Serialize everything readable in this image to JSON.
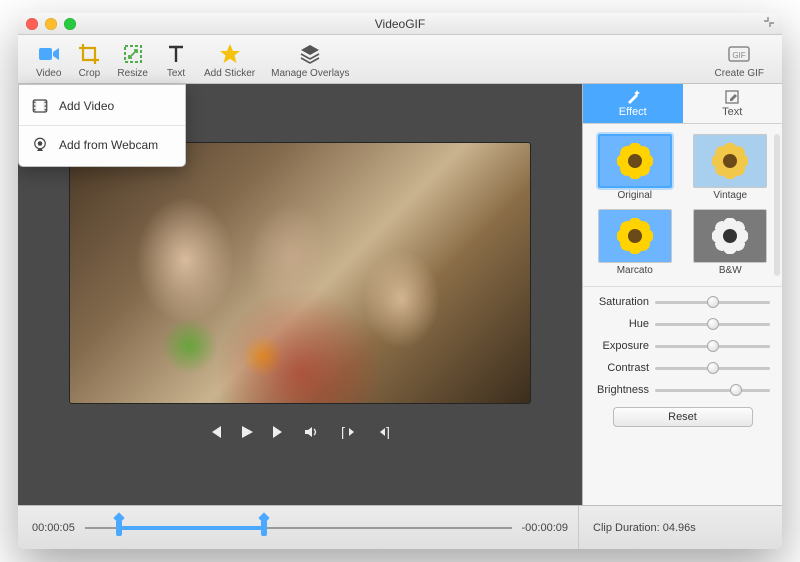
{
  "window": {
    "title": "VideoGIF"
  },
  "toolbar": {
    "items": [
      {
        "id": "video",
        "label": "Video"
      },
      {
        "id": "crop",
        "label": "Crop"
      },
      {
        "id": "resize",
        "label": "Resize"
      },
      {
        "id": "text",
        "label": "Text"
      },
      {
        "id": "sticker",
        "label": "Add Sticker"
      },
      {
        "id": "overlays",
        "label": "Manage Overlays"
      }
    ],
    "create_gif": "Create GIF"
  },
  "dropdown": {
    "add_video": "Add Video",
    "add_webcam": "Add from Webcam"
  },
  "sidebar": {
    "tabs": {
      "effect": "Effect",
      "text": "Text"
    },
    "effects": [
      {
        "id": "original",
        "label": "Original",
        "petal": "#ffd200",
        "bg": "#6db6ff",
        "selected": true
      },
      {
        "id": "vintage",
        "label": "Vintage",
        "petal": "#f2c84a",
        "bg": "#a9cfee"
      },
      {
        "id": "marcato",
        "label": "Marcato",
        "petal": "#ffd200",
        "bg": "#6db6ff"
      },
      {
        "id": "bw",
        "label": "B&W",
        "petal": "#f2f2f2",
        "bg": "#7a7a7a"
      }
    ],
    "sliders": {
      "saturation": {
        "label": "Saturation",
        "value": 0.5
      },
      "hue": {
        "label": "Hue",
        "value": 0.5
      },
      "exposure": {
        "label": "Exposure",
        "value": 0.5
      },
      "contrast": {
        "label": "Contrast",
        "value": 0.5
      },
      "brightness": {
        "label": "Brightness",
        "value": 0.7
      }
    },
    "reset": "Reset"
  },
  "timeline": {
    "start": "00:00:05",
    "end": "-00:00:09",
    "range_start_pct": 8,
    "range_end_pct": 42,
    "clip_duration_label": "Clip Duration:",
    "clip_duration_value": "04.96s"
  }
}
